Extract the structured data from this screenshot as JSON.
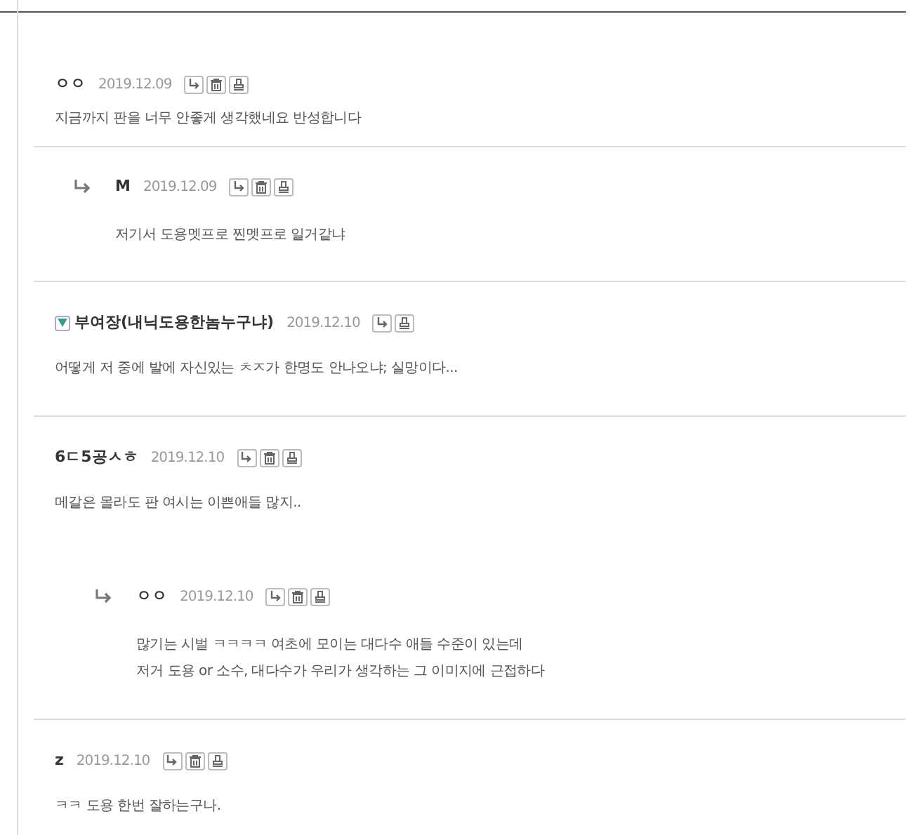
{
  "comments": [
    {
      "kind": "comment",
      "badge": false,
      "author": "ㅇㅇ",
      "date": "2019.12.09",
      "delete": true,
      "lines": [
        "지금까지 판을 너무 안좋게 생각했네요 반성합니다"
      ]
    },
    {
      "kind": "reply",
      "badge": false,
      "author": "M",
      "date": "2019.12.09",
      "delete": true,
      "lines": [
        "저기서 도용멧프로 찐멧프로 일거같냐"
      ]
    },
    {
      "kind": "comment",
      "badge": true,
      "author": "부여장(내닉도용한놈누구냐)",
      "date": "2019.12.10",
      "delete": false,
      "lines": [
        "어떻게 저 중에 발에 자신있는 ㅊㅈ가 한명도 안나오냐; 실망이다..."
      ]
    },
    {
      "kind": "comment",
      "badge": false,
      "author": "6ㄷ5공ㅅㅎ",
      "date": "2019.12.10",
      "delete": true,
      "lines": [
        "메갈은 몰라도 판 여시는 이쁜애들 많지.."
      ],
      "replies": [
        {
          "kind": "reply",
          "badge": false,
          "author": "ㅇㅇ",
          "date": "2019.12.10",
          "delete": true,
          "lines": [
            "많기는 시벌 ㅋㅋㅋㅋ 여초에 모이는 대다수 애들 수준이 있는데",
            "저거 도용 or 소수, 대다수가 우리가 생각하는 그 이미지에 근접하다"
          ]
        }
      ]
    },
    {
      "kind": "comment",
      "badge": false,
      "author": "z",
      "date": "2019.12.10",
      "delete": true,
      "lines": [
        "ㅋㅋ 도용 한번 잘하는구나."
      ]
    }
  ]
}
